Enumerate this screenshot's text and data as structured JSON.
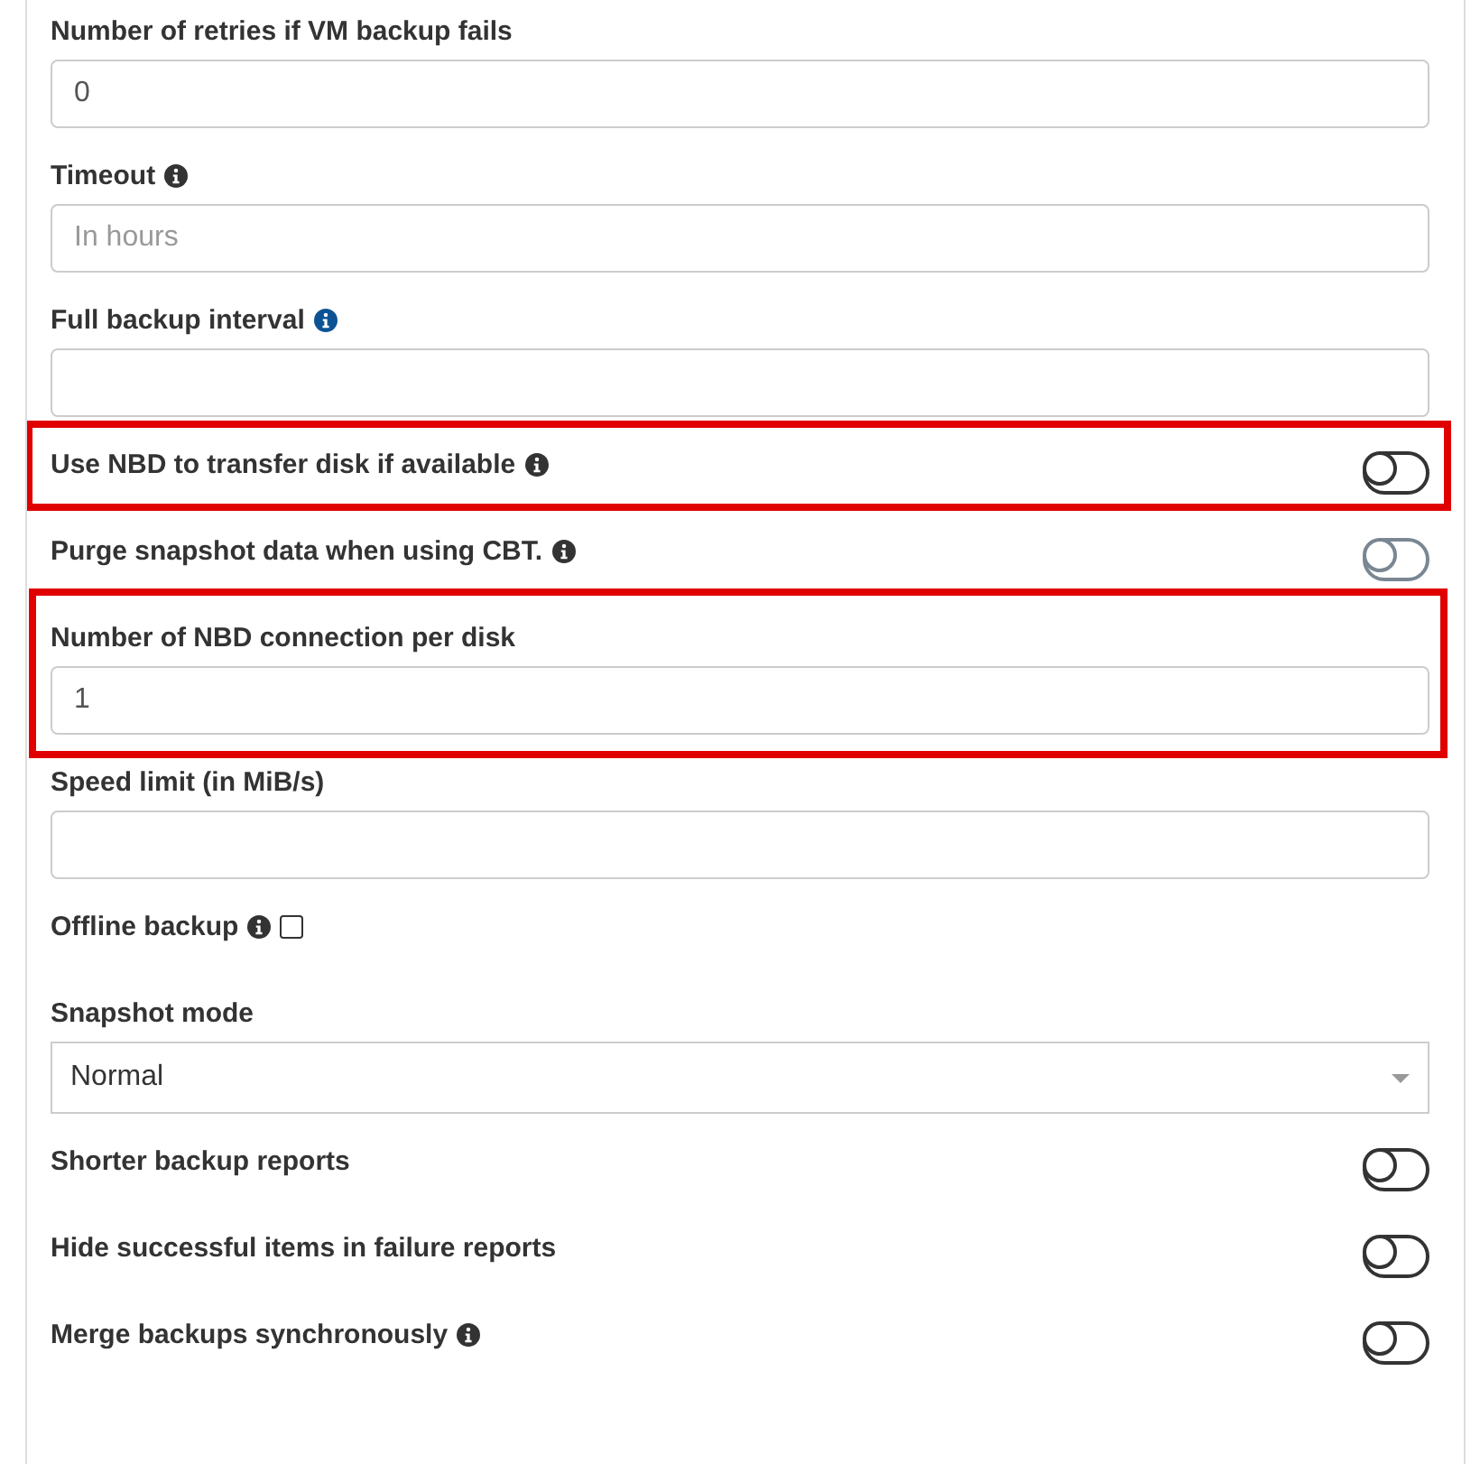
{
  "fields": [
    {
      "kind": "input",
      "label": "Number of retries if VM backup fails",
      "value": "0"
    },
    {
      "kind": "input",
      "label": "Timeout",
      "info": true,
      "info_link": false,
      "placeholder": "In hours"
    },
    {
      "kind": "input",
      "label": "Full backup interval",
      "info": true,
      "info_link": true
    },
    {
      "kind": "toggle",
      "label": "Use NBD to transfer disk if available",
      "info": true,
      "info_link": false,
      "on": false,
      "disabled": false,
      "highlighted": true
    },
    {
      "kind": "toggle",
      "label": "Purge snapshot data when using CBT.",
      "info": true,
      "info_link": false,
      "on": false,
      "disabled": true
    },
    {
      "kind": "input",
      "label": "Number of NBD connection per disk",
      "value": "1",
      "highlighted": true
    },
    {
      "kind": "input",
      "label": "Speed limit (in MiB/s)"
    },
    {
      "kind": "checkbox",
      "label": "Offline backup",
      "info": true,
      "info_link": false,
      "checked": false
    },
    {
      "kind": "select",
      "label": "Snapshot mode",
      "value": "Normal"
    },
    {
      "kind": "toggle",
      "label": "Shorter backup reports",
      "on": false,
      "disabled": false
    },
    {
      "kind": "toggle",
      "label": "Hide successful items in failure reports",
      "on": false,
      "disabled": false
    },
    {
      "kind": "toggle",
      "label": "Merge backups synchronously",
      "info": true,
      "info_link": false,
      "on": false,
      "disabled": false
    }
  ]
}
